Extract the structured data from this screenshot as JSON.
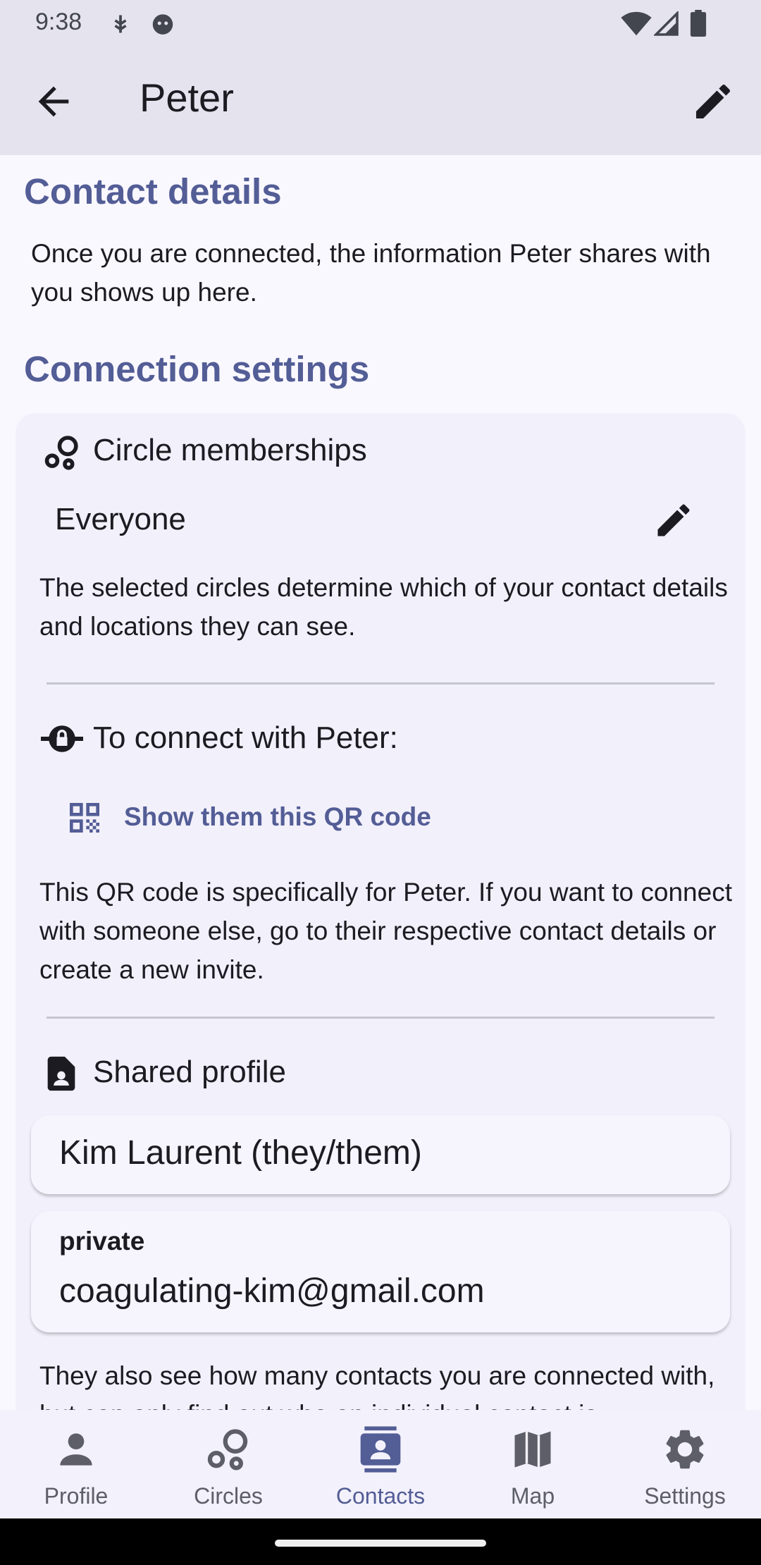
{
  "status_bar": {
    "time": "9:38"
  },
  "app_bar": {
    "title": "Peter"
  },
  "contact_details": {
    "heading": "Contact details",
    "body": "Once you are connected, the information Peter shares with you shows up here."
  },
  "connection_settings": {
    "heading": "Connection settings",
    "circles": {
      "title": "Circle memberships",
      "value": "Everyone",
      "body": "The selected circles determine which of your contact details and locations they can see."
    },
    "connect": {
      "title": "To connect with Peter:",
      "qr_link": "Show them this QR code",
      "body": "This QR code is specifically for Peter. If you want to connect with someone else, go to their respective contact details or create a new invite."
    },
    "shared_profile": {
      "title": "Shared profile",
      "name_value": "Kim Laurent (they/them)",
      "email_label": "private",
      "email_value": "coagulating-kim@gmail.com",
      "footer": "They also see how many contacts you are connected with, but can only find out who an individual contact is"
    }
  },
  "bottom_nav": {
    "items": [
      {
        "label": "Profile",
        "icon": "person-icon"
      },
      {
        "label": "Circles",
        "icon": "circles-icon"
      },
      {
        "label": "Contacts",
        "icon": "contacts-icon",
        "active": true
      },
      {
        "label": "Map",
        "icon": "map-icon"
      },
      {
        "label": "Settings",
        "icon": "gear-icon"
      }
    ]
  },
  "colors": {
    "accent": "#535d96",
    "background": "#faf8ff",
    "appbar": "#e4e3ee"
  }
}
